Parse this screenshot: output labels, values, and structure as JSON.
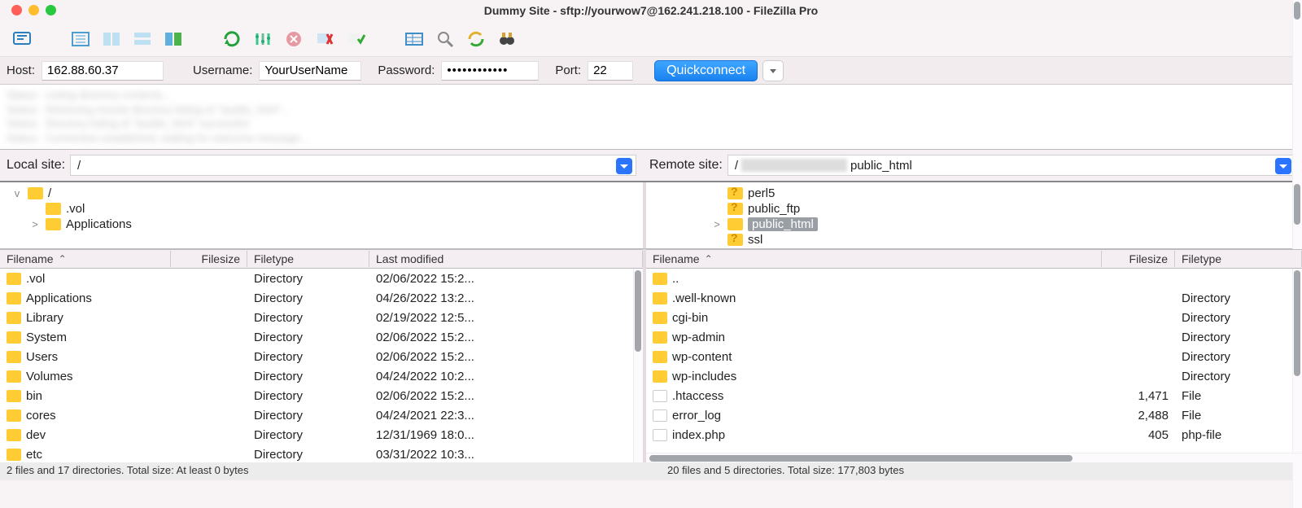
{
  "title": "Dummy Site - sftp://yourwow7@162.241.218.100 - FileZilla Pro",
  "quickconnect": {
    "host_label": "Host:",
    "host": "162.88.60.37",
    "username_label": "Username:",
    "username": "YourUserName",
    "password_label": "Password:",
    "password": "••••••••••••",
    "port_label": "Port:",
    "port": "22",
    "button": "Quickconnect"
  },
  "local": {
    "label": "Local site:",
    "path": "/",
    "tree": [
      {
        "indent": 0,
        "expander": "v",
        "icon": "folder",
        "name": "/"
      },
      {
        "indent": 1,
        "expander": "",
        "icon": "folder",
        "name": ".vol"
      },
      {
        "indent": 1,
        "expander": ">",
        "icon": "folder",
        "name": "Applications"
      }
    ],
    "columns": {
      "name": "Filename",
      "size": "Filesize",
      "type": "Filetype",
      "mod": "Last modified"
    },
    "files": [
      {
        "name": ".vol",
        "type": "Directory",
        "mod": "02/06/2022 15:2..."
      },
      {
        "name": "Applications",
        "type": "Directory",
        "mod": "04/26/2022 13:2..."
      },
      {
        "name": "Library",
        "type": "Directory",
        "mod": "02/19/2022 12:5..."
      },
      {
        "name": "System",
        "type": "Directory",
        "mod": "02/06/2022 15:2..."
      },
      {
        "name": "Users",
        "type": "Directory",
        "mod": "02/06/2022 15:2..."
      },
      {
        "name": "Volumes",
        "type": "Directory",
        "mod": "04/24/2022 10:2..."
      },
      {
        "name": "bin",
        "type": "Directory",
        "mod": "02/06/2022 15:2..."
      },
      {
        "name": "cores",
        "type": "Directory",
        "mod": "04/24/2021 22:3..."
      },
      {
        "name": "dev",
        "type": "Directory",
        "mod": "12/31/1969 18:0..."
      },
      {
        "name": "etc",
        "type": "Directory",
        "mod": "03/31/2022 10:3..."
      }
    ],
    "status": "2 files and 17 directories. Total size: At least 0 bytes"
  },
  "remote": {
    "label": "Remote site:",
    "path_prefix": "/",
    "path_suffix": "public_html",
    "tree": [
      {
        "indent": 3,
        "expander": "",
        "icon": "unknown",
        "name": "perl5"
      },
      {
        "indent": 3,
        "expander": "",
        "icon": "unknown",
        "name": "public_ftp"
      },
      {
        "indent": 3,
        "expander": ">",
        "icon": "folder",
        "name": "public_html",
        "selected": true
      },
      {
        "indent": 3,
        "expander": "",
        "icon": "unknown",
        "name": "ssl"
      }
    ],
    "columns": {
      "name": "Filename",
      "size": "Filesize",
      "type": "Filetype"
    },
    "files": [
      {
        "name": "..",
        "icon": "folder",
        "size": "",
        "type": ""
      },
      {
        "name": ".well-known",
        "icon": "folder",
        "size": "",
        "type": "Directory"
      },
      {
        "name": "cgi-bin",
        "icon": "folder",
        "size": "",
        "type": "Directory"
      },
      {
        "name": "wp-admin",
        "icon": "folder",
        "size": "",
        "type": "Directory"
      },
      {
        "name": "wp-content",
        "icon": "folder",
        "size": "",
        "type": "Directory"
      },
      {
        "name": "wp-includes",
        "icon": "folder",
        "size": "",
        "type": "Directory"
      },
      {
        "name": ".htaccess",
        "icon": "file",
        "size": "1,471",
        "type": "File"
      },
      {
        "name": "error_log",
        "icon": "file",
        "size": "2,488",
        "type": "File"
      },
      {
        "name": "index.php",
        "icon": "file",
        "size": "405",
        "type": "php-file"
      }
    ],
    "status": "20 files and 5 directories. Total size: 177,803 bytes"
  },
  "toolbar_icons": [
    "site-manager-icon",
    "layout-tree-icon",
    "layout-split-icon",
    "layout-list-icon",
    "layout-sync-icon",
    "refresh-icon",
    "filter-icon",
    "cancel-icon",
    "disconnect-icon",
    "reconnect-icon",
    "queue-icon",
    "search-icon",
    "compare-icon",
    "binoculars-icon"
  ]
}
